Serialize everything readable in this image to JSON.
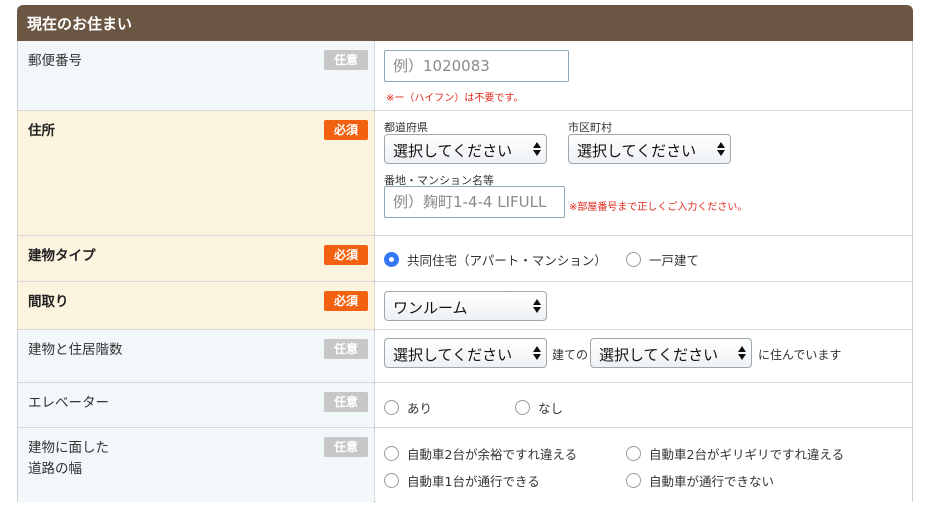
{
  "header": {
    "title": "現在のお住まい"
  },
  "badges": {
    "optional": "任意",
    "required": "必須"
  },
  "rows": {
    "postal": {
      "label": "郵便番号",
      "placeholder": "例）1020083",
      "note": "※ー（ハイフン）は不要です。"
    },
    "address": {
      "label": "住所",
      "prefecture_label": "都道府県",
      "prefecture_value": "選択してください",
      "city_label": "市区町村",
      "city_value": "選択してください",
      "street_label": "番地・マンション名等",
      "street_placeholder": "例）麹町1-4-4 LIFULL",
      "street_note": "※部屋番号まで正しくご入力ください。"
    },
    "building_type": {
      "label": "建物タイプ",
      "options": [
        {
          "label": "共同住宅（アパート・マンション）",
          "checked": true
        },
        {
          "label": "一戸建て",
          "checked": false
        }
      ]
    },
    "layout": {
      "label": "間取り",
      "value": "ワンルーム"
    },
    "floors": {
      "label": "建物と住居階数",
      "building_value": "選択してください",
      "mid_text": "建ての",
      "floor_value": "選択してください",
      "tail_text": "に住んでいます"
    },
    "elevator": {
      "label": "エレベーター",
      "options": [
        {
          "label": "あり",
          "checked": false
        },
        {
          "label": "なし",
          "checked": false
        }
      ]
    },
    "road": {
      "label_line1": "建物に面した",
      "label_line2": "道路の幅",
      "options": [
        {
          "label": "自動車2台が余裕ですれ違える",
          "checked": false
        },
        {
          "label": "自動車2台がギリギリですれ違える",
          "checked": false
        },
        {
          "label": "自動車1台が通行できる",
          "checked": false
        },
        {
          "label": "自動車が通行できない",
          "checked": false
        }
      ]
    }
  },
  "colors": {
    "header_bg": "#6b5644",
    "required_badge": "#f2610f",
    "optional_badge": "#c7c7c7",
    "note_red": "#e0271d",
    "radio_checked": "#3478f6"
  }
}
